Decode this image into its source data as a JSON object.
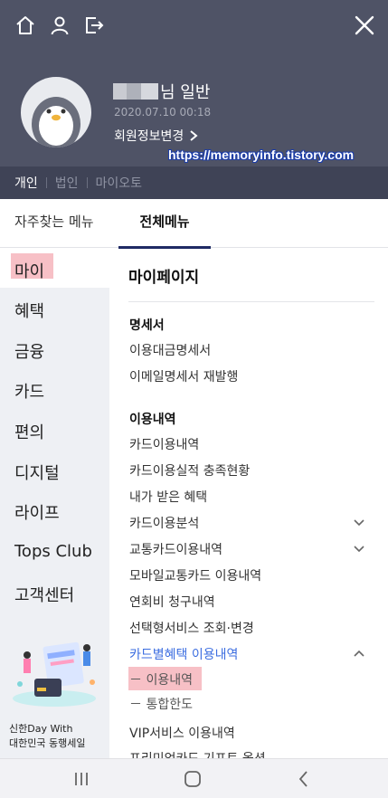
{
  "header": {
    "name_suffix": "님 일반",
    "last_login": "2020.07.10 00:18",
    "edit_profile_label": "회원정보변경",
    "watermark": "https://memoryinfo.tistory.com"
  },
  "account_tabs": [
    "개인",
    "법인",
    "마이오토"
  ],
  "menu_tabs": [
    "자주찾는 메뉴",
    "전체메뉴"
  ],
  "categories": [
    "마이",
    "혜택",
    "금융",
    "카드",
    "편의",
    "디지털",
    "라이프",
    "Tops Club",
    "고객센터"
  ],
  "promo": {
    "line1": "신한Day With",
    "line2": "대한민국 동행세일"
  },
  "content": {
    "page_title": "마이페이지",
    "section1": {
      "title": "명세서",
      "items": [
        "이용대금명세서",
        "이메일명세서 재발행"
      ]
    },
    "section2": {
      "title": "이용내역",
      "items": [
        "카드이용내역",
        "카드이용실적 충족현황",
        "내가 받은 혜택",
        "카드이용분석",
        "교통카드이용내역",
        "모바일교통카드 이용내역",
        "연회비 청구내역",
        "선택형서비스 조회·변경",
        "카드별혜택 이용내역"
      ],
      "subitems": [
        "－ 이용내역",
        "－ 통합한도"
      ],
      "more": [
        "VIP서비스 이용내역",
        "프리미엄카드 기프트 옵션"
      ]
    }
  },
  "colors": {
    "header_bg": "#4f5366",
    "accent_blue": "#3b6de0",
    "highlight_pink": "#f7c0c6"
  }
}
